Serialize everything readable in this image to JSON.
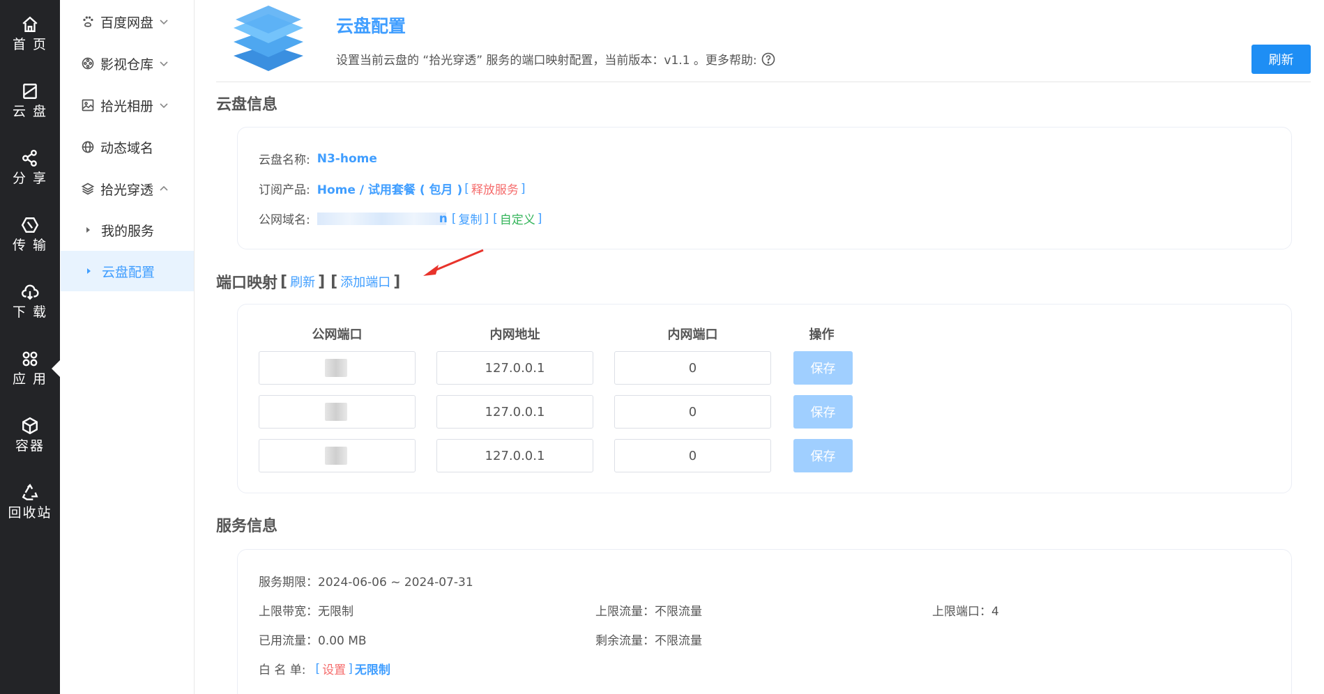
{
  "rail": {
    "items": [
      {
        "label": "首 页",
        "icon": "home-icon"
      },
      {
        "label": "云 盘",
        "icon": "disk-icon"
      },
      {
        "label": "分 享",
        "icon": "share-icon"
      },
      {
        "label": "传 输",
        "icon": "transfer-icon"
      },
      {
        "label": "下 载",
        "icon": "download-icon"
      },
      {
        "label": "应 用",
        "icon": "apps-icon"
      },
      {
        "label": "容器",
        "icon": "container-icon"
      },
      {
        "label": "回收站",
        "icon": "recycle-icon"
      }
    ],
    "active": "应 用"
  },
  "sidebar": {
    "items": [
      {
        "label": "百度网盘",
        "icon": "paw-icon"
      },
      {
        "label": "影视仓库",
        "icon": "film-reel-icon"
      },
      {
        "label": "拾光相册",
        "icon": "image-icon"
      },
      {
        "label": "动态域名",
        "icon": "globe-icon"
      },
      {
        "label": "拾光穿透",
        "icon": "layers-icon"
      }
    ],
    "sub": [
      {
        "label": "我的服务"
      },
      {
        "label": "云盘配置"
      }
    ],
    "active_sub": "云盘配置"
  },
  "header": {
    "title": "云盘配置",
    "description": "设置当前云盘的 “拾光穿透” 服务的端口映射配置，当前版本：v1.1 。更多帮助:",
    "refresh_label": "刷新"
  },
  "disk_info": {
    "section_title": "云盘信息",
    "name_label": "云盘名称:",
    "name_value": "N3-home",
    "product_label": "订阅产品:",
    "product_value": "Home / 试用套餐 ( 包月 )",
    "release_label": "释放服务",
    "domain_label": "公网域名:",
    "domain_tail": "n",
    "copy_label": "复制",
    "custom_label": "自定义",
    "bracket_open": "[",
    "bracket_close": "]"
  },
  "port_mapping": {
    "section_title": "端口映射",
    "refresh_link": "刷新",
    "add_link": "添加端口",
    "columns": [
      "公网端口",
      "内网地址",
      "内网端口",
      "操作"
    ],
    "rows": [
      {
        "public_port": "10",
        "inner_address": "127.0.0.1",
        "inner_port": "0",
        "action": "保存"
      },
      {
        "public_port": "10",
        "inner_address": "127.0.0.1",
        "inner_port": "0",
        "action": "保存"
      },
      {
        "public_port": "10",
        "inner_address": "127.0.0.1",
        "inner_port": "0",
        "action": "保存"
      }
    ]
  },
  "service_info": {
    "section_title": "服务信息",
    "period": "服务期限：2024-06-06 ~ 2024-07-31",
    "bandwidth": "上限带宽：无限制",
    "traffic_limit": "上限流量：不限流量",
    "port_limit": "上限端口：4",
    "used_traffic": "已用流量：0.00 MB",
    "remaining_traffic": "剩余流量：不限流量",
    "whitelist_label": "白 名 单:",
    "whitelist_set": "设置",
    "whitelist_value": "无限制"
  },
  "colors": {
    "primary": "#409eff",
    "danger": "#f56c6c",
    "success": "#34b45a",
    "rail_bg": "#232427"
  }
}
